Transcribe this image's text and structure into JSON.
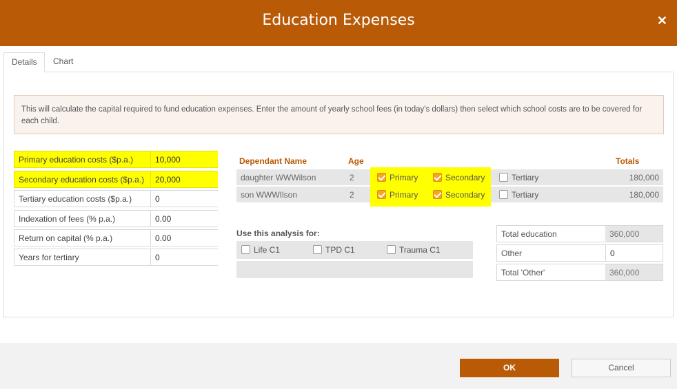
{
  "dialog": {
    "title": "Education Expenses"
  },
  "tabs": [
    {
      "label": "Details"
    },
    {
      "label": "Chart"
    }
  ],
  "info_text": "This will calculate the capital required to fund education expenses. Enter the amount of yearly school fees (in today's dollars) then select which school costs are to be covered for each child.",
  "fields": [
    {
      "label": "Primary education costs ($p.a.)",
      "value": "10,000",
      "highlighted": true
    },
    {
      "label": "Secondary education costs ($p.a.)",
      "value": "20,000",
      "highlighted": true
    },
    {
      "label": "Tertiary education costs ($p.a.)",
      "value": "0"
    },
    {
      "label": "Indexation of fees (% p.a.)",
      "value": "0.00"
    },
    {
      "label": "Return on capital (% p.a.)",
      "value": "0.00"
    },
    {
      "label": "Years for tertiary",
      "value": "0"
    }
  ],
  "dependants": {
    "headers": {
      "name": "Dependant Name",
      "age": "Age",
      "totals": "Totals"
    },
    "rows": [
      {
        "name": "daughter WWWilson",
        "age": "2",
        "primary": true,
        "secondary": true,
        "tertiary": false,
        "total": "180,000"
      },
      {
        "name": "son WWWIlson",
        "age": "2",
        "primary": true,
        "secondary": true,
        "tertiary": false,
        "total": "180,000"
      }
    ],
    "labels": {
      "primary": "Primary",
      "secondary": "Secondary",
      "tertiary": "Tertiary"
    }
  },
  "use_analysis": {
    "title": "Use this analysis for:",
    "options": [
      {
        "label": "Life C1",
        "checked": false
      },
      {
        "label": "TPD C1",
        "checked": false
      },
      {
        "label": "Trauma C1",
        "checked": false
      }
    ]
  },
  "totals": [
    {
      "label": "Total education",
      "value": "360,000",
      "editable": false
    },
    {
      "label": "Other",
      "value": "0",
      "editable": true
    },
    {
      "label": "Total 'Other'",
      "value": "360,000",
      "editable": false
    }
  ],
  "buttons": {
    "ok": "OK",
    "cancel": "Cancel"
  },
  "colors": {
    "brand": "#b95a06",
    "highlight": "#ffff00",
    "checkbox_on": "#f5a623"
  }
}
